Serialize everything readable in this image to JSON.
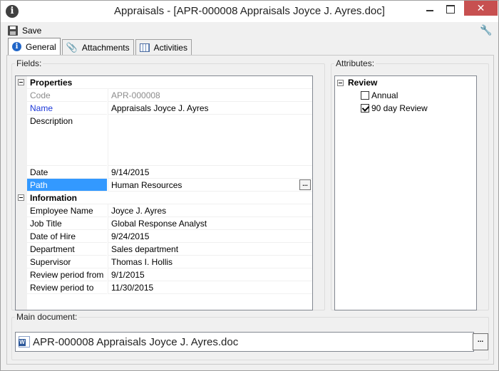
{
  "window": {
    "title": "Appraisals - [APR-000008 Appraisals Joyce J. Ayres.doc]",
    "close_glyph": "✕"
  },
  "toolbar": {
    "save_label": "Save"
  },
  "tabs": [
    {
      "label": "General",
      "icon": "info-icon",
      "active": true
    },
    {
      "label": "Attachments",
      "icon": "paperclip-icon",
      "active": false
    },
    {
      "label": "Activities",
      "icon": "calendar-icon",
      "active": false
    }
  ],
  "fields": {
    "legend": "Fields:",
    "properties_label": "Properties",
    "information_label": "Information",
    "code": {
      "name": "Code",
      "value": "APR-000008"
    },
    "name": {
      "name": "Name",
      "value": "Appraisals Joyce J. Ayres"
    },
    "description": {
      "name": "Description",
      "value": ""
    },
    "date": {
      "name": "Date",
      "value": "9/14/2015"
    },
    "path": {
      "name": "Path",
      "value": "Human Resources"
    },
    "employee_name": {
      "name": "Employee Name",
      "value": "Joyce J. Ayres"
    },
    "job_title": {
      "name": "Job Title",
      "value": "Global Response Analyst"
    },
    "date_of_hire": {
      "name": "Date of Hire",
      "value": "9/24/2015"
    },
    "department": {
      "name": "Department",
      "value": "Sales department"
    },
    "supervisor": {
      "name": "Supervisor",
      "value": "Thomas I. Hollis"
    },
    "review_from": {
      "name": "Review period from",
      "value": "9/1/2015"
    },
    "review_to": {
      "name": "Review period to",
      "value": "11/30/2015"
    },
    "ellipsis": "..."
  },
  "attributes": {
    "legend": "Attributes:",
    "group_label": "Review",
    "annual": {
      "label": "Annual",
      "checked": false
    },
    "ninety_day": {
      "label": "90 day Review",
      "checked": true
    }
  },
  "main_document": {
    "legend": "Main document:",
    "file_name": "APR-000008 Appraisals Joyce J. Ayres.doc",
    "browse": "..."
  },
  "colors": {
    "selection": "#3399ff",
    "modified_label": "#1a36d8",
    "close_button": "#c75050"
  }
}
